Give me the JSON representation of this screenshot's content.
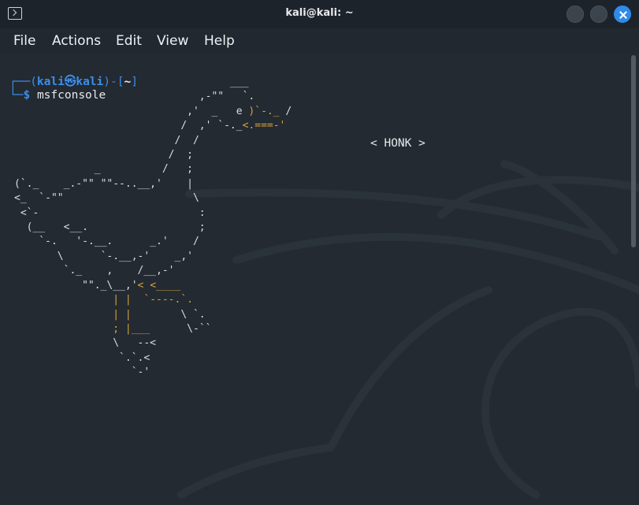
{
  "window": {
    "title": "kali@kali: ~",
    "accent_color": "#2e8bea",
    "controls": [
      "minimize-button",
      "maximize-button",
      "close-button"
    ]
  },
  "menu": [
    "File",
    "Actions",
    "Edit",
    "View",
    "Help"
  ],
  "prompt": {
    "open": "┌──(",
    "user": "kali",
    "at": "㉿",
    "host": "kali",
    "mid": ")-[",
    "dir": "~",
    "close": "]",
    "line2": "└─",
    "symbol": "$",
    "command": "msfconsole"
  },
  "banner": {
    "speech": "< HONK >"
  }
}
